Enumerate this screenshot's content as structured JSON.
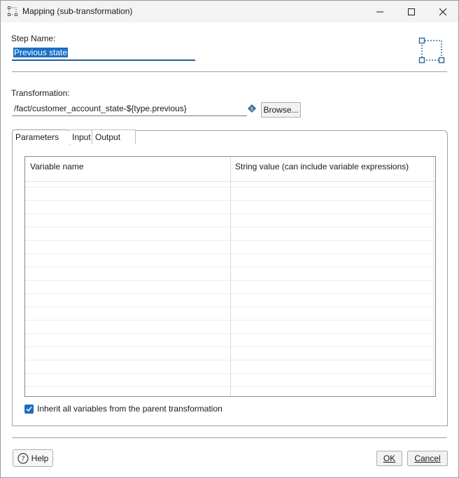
{
  "window": {
    "title": "Mapping (sub-transformation)",
    "icons": {
      "title": "mapping-step-icon",
      "minimize": "minimize-icon",
      "maximize": "maximize-icon",
      "close": "close-icon"
    }
  },
  "step": {
    "label": "Step Name:",
    "value": "Previous state",
    "icon": "mapping-step-icon"
  },
  "transformation": {
    "label": "Transformation:",
    "value": "/fact/customer_account_state-${type.previous}",
    "variable_icon": "variable-diamond-icon",
    "browse_label": "Browse..."
  },
  "tabs": [
    {
      "label": "Parameters",
      "selected": true
    },
    {
      "label": "Input",
      "selected": false
    },
    {
      "label": "Output",
      "selected": false
    }
  ],
  "grid": {
    "columns": [
      "Variable name",
      "String value (can include variable expressions)"
    ],
    "rows": []
  },
  "inherit": {
    "label": "Inherit all variables from the parent transformation",
    "checked": true
  },
  "buttons": {
    "help": "Help",
    "ok": "OK",
    "cancel": "Cancel"
  },
  "colors": {
    "accent": "#1a6fc4",
    "selection": "#1a6fc4"
  }
}
